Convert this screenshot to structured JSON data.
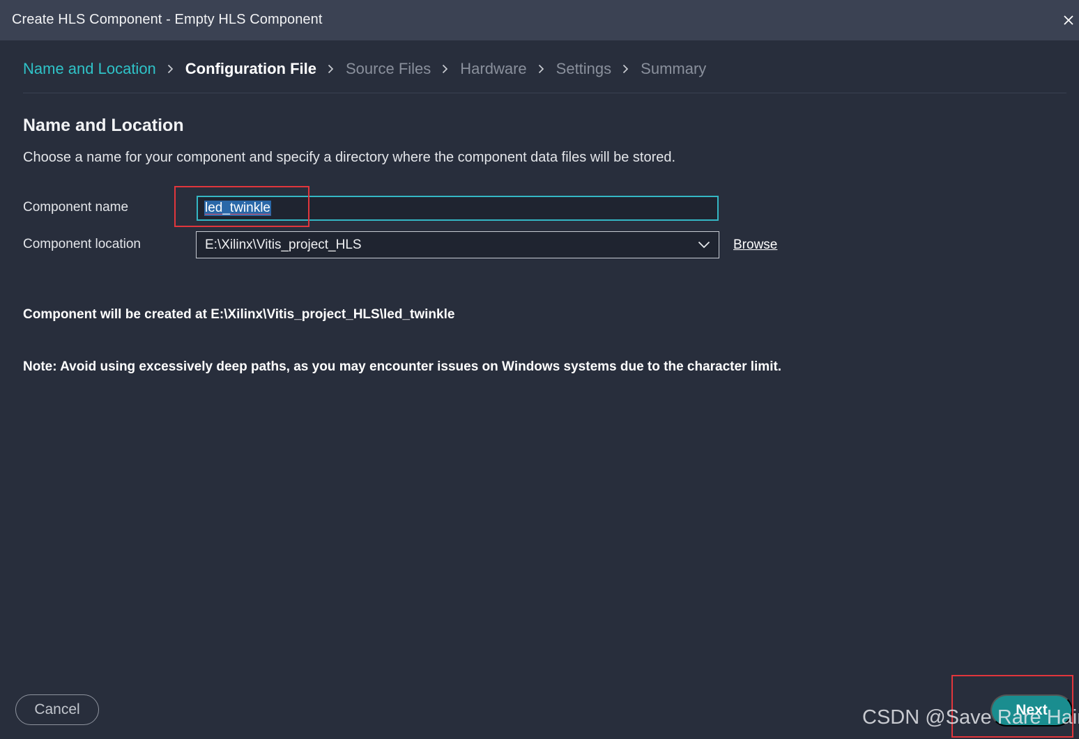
{
  "window": {
    "title": "Create HLS Component - Empty HLS Component",
    "close_icon": "close-icon"
  },
  "breadcrumb": {
    "steps": [
      {
        "label": "Name and Location",
        "state": "done"
      },
      {
        "label": "Configuration File",
        "state": "active"
      },
      {
        "label": "Source Files",
        "state": "pending"
      },
      {
        "label": "Hardware",
        "state": "pending"
      },
      {
        "label": "Settings",
        "state": "pending"
      },
      {
        "label": "Summary",
        "state": "pending"
      }
    ],
    "separator_icon": "chevron-right-icon"
  },
  "content": {
    "section_title": "Name and Location",
    "description": "Choose a name for your component and specify a directory where the component data files will be stored.",
    "component_name_label": "Component name",
    "component_name_value": "led_twinkle",
    "component_location_label": "Component location",
    "component_location_value": "E:\\Xilinx\\Vitis_project_HLS",
    "browse_label": "Browse",
    "created_at": "Component will be created at E:\\Xilinx\\Vitis_project_HLS\\led_twinkle",
    "note_label": "Note:",
    "note_text": " Avoid using excessively deep paths, as you may encounter issues on Windows systems due to the character limit."
  },
  "footer": {
    "cancel_label": "Cancel",
    "next_label": "Next"
  },
  "watermark": "CSDN @Save Rare Hair",
  "colors": {
    "background": "#282e3c",
    "titlebar": "#3b4253",
    "accent": "#2fc3c8",
    "next_button": "#1a8d8f",
    "highlight": "#e2363c"
  }
}
